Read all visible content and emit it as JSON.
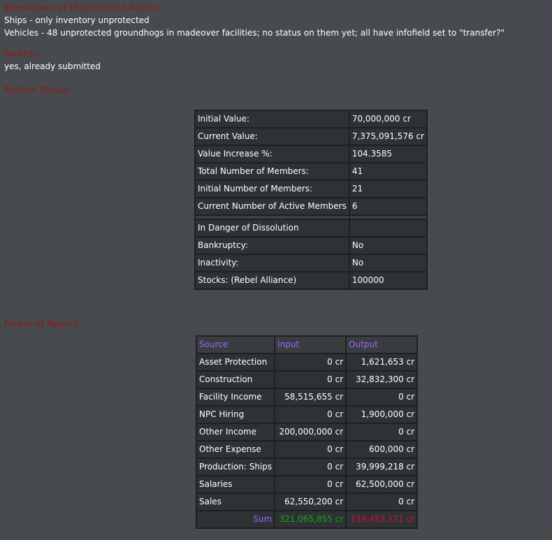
{
  "unprotected": {
    "heading": "Breakdown of Unprotected Assets:",
    "ships": "Ships - only inventory unprotected",
    "vehicles": "Vehicles - 48 unprotected groundhogs in madeover facilities; no status on them yet; all have infofield set to \"transfer?\""
  },
  "awards": {
    "heading": "Awards:",
    "text": "yes, already submitted"
  },
  "faction_status": {
    "heading": "Faction Status:",
    "rows": [
      {
        "label": "Initial Value:",
        "value": "70,000,000 cr"
      },
      {
        "label": "Current Value:",
        "value": "7,375,091,576 cr"
      },
      {
        "label": "Value Increase %:",
        "value": "104.3585"
      },
      {
        "label": "Total Number of Members:",
        "value": "41"
      },
      {
        "label": "Initial Number of Members:",
        "value": "21"
      },
      {
        "label": "Current Number of Active Members",
        "value": "6"
      }
    ],
    "danger_rows": [
      {
        "label": "In Danger of Dissolution",
        "value": ""
      },
      {
        "label": "Bankruptcy:",
        "value": "No"
      },
      {
        "label": "Inactivity:",
        "value": "No"
      },
      {
        "label": "Stocks: (Rebel Alliance)",
        "value": "100000"
      }
    ]
  },
  "financial_report": {
    "heading": "Financial Report:",
    "headers": [
      "Source",
      "Input",
      "Output"
    ],
    "rows": [
      {
        "source": "Asset Protection",
        "input": "0 cr",
        "output": "1,621,653 cr"
      },
      {
        "source": "Construction",
        "input": "0 cr",
        "output": "32,832,300 cr"
      },
      {
        "source": "Facility Income",
        "input": "58,515,655 cr",
        "output": "0 cr"
      },
      {
        "source": "NPC Hiring",
        "input": "0 cr",
        "output": "1,900,000 cr"
      },
      {
        "source": "Other Income",
        "input": "200,000,000 cr",
        "output": "0 cr"
      },
      {
        "source": "Other Expense",
        "input": "0 cr",
        "output": "600,000 cr"
      },
      {
        "source": "Production: Ships",
        "input": "0 cr",
        "output": "39,999,218 cr"
      },
      {
        "source": "Salaries",
        "input": "0 cr",
        "output": "62,500,000 cr"
      },
      {
        "source": "Sales",
        "input": "62,550,200 cr",
        "output": "0 cr"
      }
    ],
    "sum": {
      "label": "Sum",
      "input": "321,065,855 cr",
      "output": "139,453,171 cr"
    }
  },
  "colors": {
    "background": "#474b4f",
    "heading": "#8b1a1a",
    "header_text": "#9966ff",
    "sum_input": "#11aa11",
    "sum_output": "#cc1133"
  }
}
